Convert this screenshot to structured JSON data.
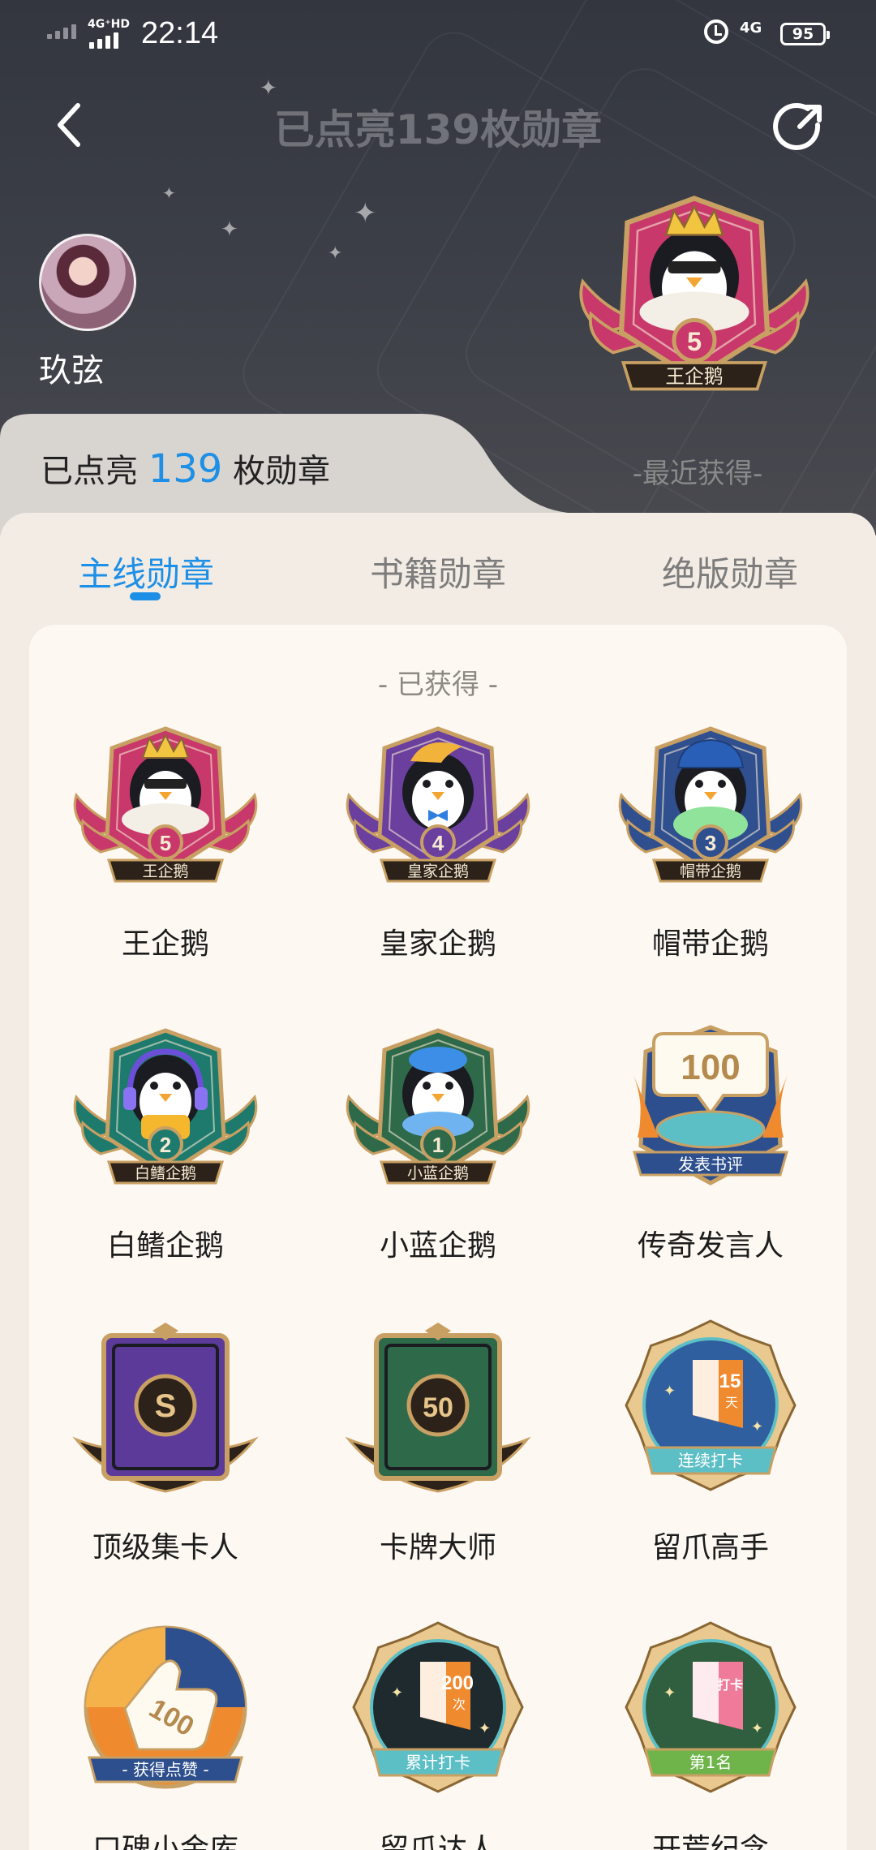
{
  "status_bar": {
    "time": "22:14",
    "network_left": "4G⁺HD",
    "network_right": "4G",
    "battery": "95"
  },
  "header": {
    "title": "已点亮139枚勋章",
    "user_name": "玖弦",
    "recent_label": "-最近获得-",
    "recent_badge": {
      "name": "王企鹅",
      "level": "5",
      "color": "#c8386a"
    },
    "count_prefix": "已点亮",
    "count_number": "139",
    "count_suffix": "枚勋章"
  },
  "tabs": [
    {
      "label": "主线勋章",
      "active": true
    },
    {
      "label": "书籍勋章",
      "active": false
    },
    {
      "label": "绝版勋章",
      "active": false
    }
  ],
  "section_label": "- 已获得 -",
  "badges": [
    {
      "name": "王企鹅",
      "ribbon": "王企鹅",
      "level": "5",
      "kind": "penguin",
      "color": "#c8386a",
      "accessory": "crown"
    },
    {
      "name": "皇家企鹅",
      "ribbon": "皇家企鹅",
      "level": "4",
      "kind": "penguin",
      "color": "#6a3f9e",
      "accessory": "crest"
    },
    {
      "name": "帽带企鹅",
      "ribbon": "帽带企鹅",
      "level": "3",
      "kind": "penguin",
      "color": "#2f4f8f",
      "accessory": "hat"
    },
    {
      "name": "白鳍企鹅",
      "ribbon": "白鳍企鹅",
      "level": "2",
      "kind": "penguin",
      "color": "#1f7a6e",
      "accessory": "headphones"
    },
    {
      "name": "小蓝企鹅",
      "ribbon": "小蓝企鹅",
      "level": "1",
      "kind": "penguin",
      "color": "#2e6a4a",
      "accessory": "cap"
    },
    {
      "name": "传奇发言人",
      "ribbon": "发表书评",
      "level": "100",
      "kind": "speech",
      "color": "#2d4f8e"
    },
    {
      "name": "顶级集卡人",
      "ribbon": "",
      "level": "S",
      "kind": "card",
      "color": "#5b3a9a"
    },
    {
      "name": "卡牌大师",
      "ribbon": "",
      "level": "50",
      "kind": "card",
      "color": "#2e6a4a"
    },
    {
      "name": "留爪高手",
      "ribbon": "连续打卡",
      "level": "15",
      "sub": "天",
      "kind": "checkin",
      "color": "#2f5f9e"
    },
    {
      "name": "口碑小金库",
      "ribbon": "获得点赞",
      "level": "100",
      "kind": "like",
      "color": "#2d4f8e"
    },
    {
      "name": "留爪达人",
      "ribbon": "累计打卡",
      "level": "200",
      "sub": "次",
      "kind": "checkin2",
      "color": "#1f2a2f"
    },
    {
      "name": "开荒纪念",
      "ribbon": "第1名",
      "level": "打卡",
      "kind": "first",
      "color": "#2f5f3e"
    }
  ]
}
